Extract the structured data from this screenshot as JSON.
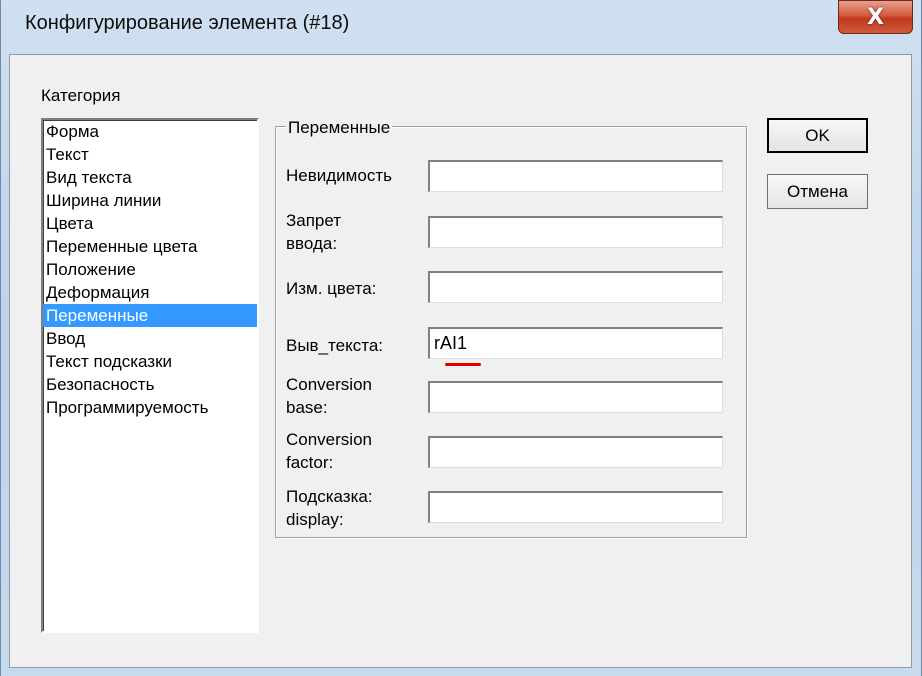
{
  "window": {
    "title": "Конфигурирование элемента (#18)",
    "close_glyph": "X"
  },
  "category": {
    "label": "Категория",
    "items": [
      "Форма",
      "Текст",
      "Вид текста",
      "Ширина линии",
      "Цвета",
      "Переменные цвета",
      "Положение",
      "Деформация",
      "Переменные",
      "Ввод",
      "Текст подсказки",
      "Безопасность",
      "Программируемость"
    ],
    "selected": "Переменные"
  },
  "variables": {
    "group_title": "Переменные",
    "fields": [
      {
        "label_lines": [
          "Невидимость"
        ],
        "value": ""
      },
      {
        "label_lines": [
          "Запрет",
          "ввода:"
        ],
        "value": ""
      },
      {
        "label_lines": [
          "Изм. цвета:"
        ],
        "value": ""
      },
      {
        "label_lines": [
          "Выв_текста:"
        ],
        "value": "rAI1"
      },
      {
        "label_lines": [
          "Conversion",
          "base:"
        ],
        "value": ""
      },
      {
        "label_lines": [
          "Conversion",
          "factor:"
        ],
        "value": ""
      },
      {
        "label_lines": [
          "Подсказка:",
          "display:"
        ],
        "value": ""
      }
    ]
  },
  "buttons": {
    "ok": "OK",
    "cancel": "Отмена"
  },
  "colors": {
    "selection": "#3399ff",
    "close_button": "#c0391d",
    "spellcheck_underline": "#e00000"
  }
}
